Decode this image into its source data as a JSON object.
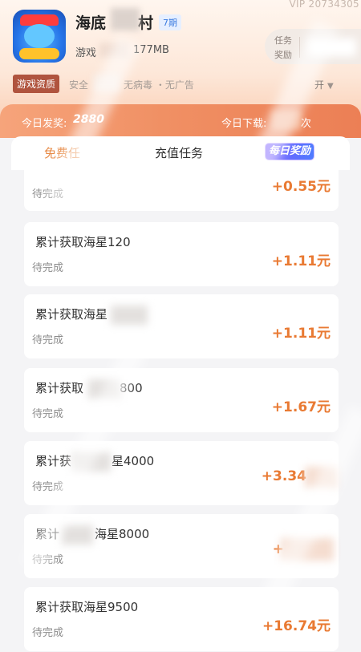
{
  "header": {
    "vip_id": "VIP 20734305",
    "app_name": "海底",
    "app_name_tail": "村",
    "period_badge": "7期",
    "game_label": "游戏",
    "game_size": "177MB",
    "task_reward_label_1": "任务",
    "task_reward_label_2": "奖励"
  },
  "qualification": {
    "tag": "游戏资质",
    "safe": "安全",
    "features": "无病毒 ・无广告",
    "toggle_label": "开"
  },
  "banner": {
    "today_payout_label": "今日发奖:",
    "today_payout_value": "2880",
    "today_download_label": "今日下载:",
    "today_download_unit": "次"
  },
  "tabs": {
    "free": "免费任",
    "charge": "充值任务",
    "daily": "每日奖励"
  },
  "tasks": [
    {
      "title": "",
      "status": "待完成",
      "amount": "+0.55元"
    },
    {
      "title": "累计获取海星120",
      "status": "待完成",
      "amount": "+1.11元"
    },
    {
      "title": "累计获取海星",
      "status": "待完成",
      "amount": "+1.11元"
    },
    {
      "title": "累计获取",
      "title_tail": "800",
      "status": "待完成",
      "amount": "+1.67元"
    },
    {
      "title": "累计获",
      "title_tail": "星4000",
      "status": "待完成",
      "amount": "+3.34"
    },
    {
      "title": "累计",
      "title_tail": "海星8000",
      "status": "待完成",
      "amount": "+"
    },
    {
      "title": "累计获取海星9500",
      "status": "待完成",
      "amount": "+16.74元"
    }
  ]
}
